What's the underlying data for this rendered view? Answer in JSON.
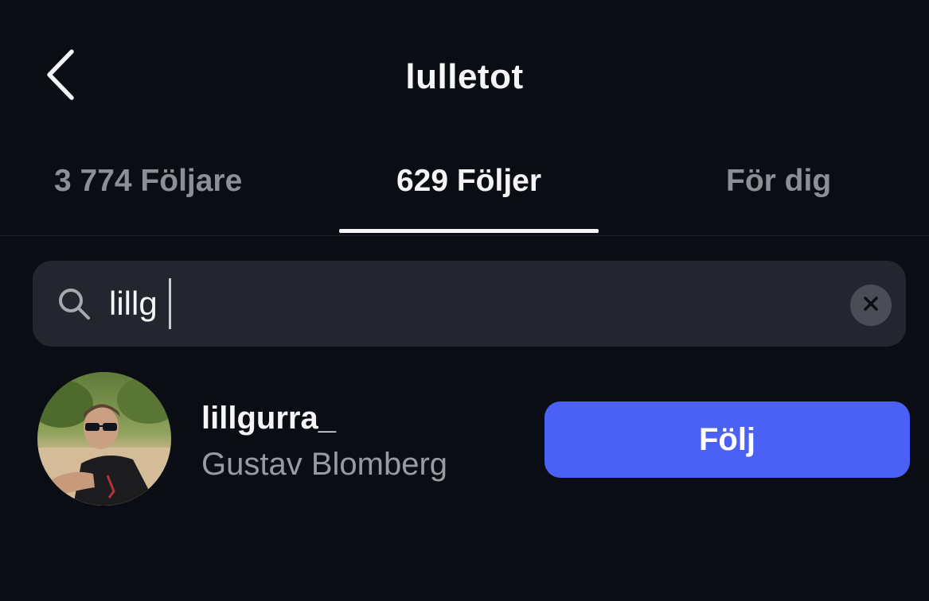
{
  "header": {
    "title": "lulletot",
    "back_icon": "chevron-left-icon"
  },
  "tabs": [
    {
      "label": "3 774 Följare",
      "active": false
    },
    {
      "label": "629 Följer",
      "active": true
    },
    {
      "label": "För dig",
      "active": false
    }
  ],
  "search": {
    "value": "lillg",
    "icon": "search-icon",
    "clear_icon": "close-icon"
  },
  "results": [
    {
      "username": "lillgurra_",
      "full_name": "Gustav Blomberg",
      "button_label": "Följ",
      "button_color": "#4b60f4"
    }
  ],
  "colors": {
    "background": "#0b0d14",
    "search_bg": "#23262e",
    "accent": "#4b60f4"
  }
}
